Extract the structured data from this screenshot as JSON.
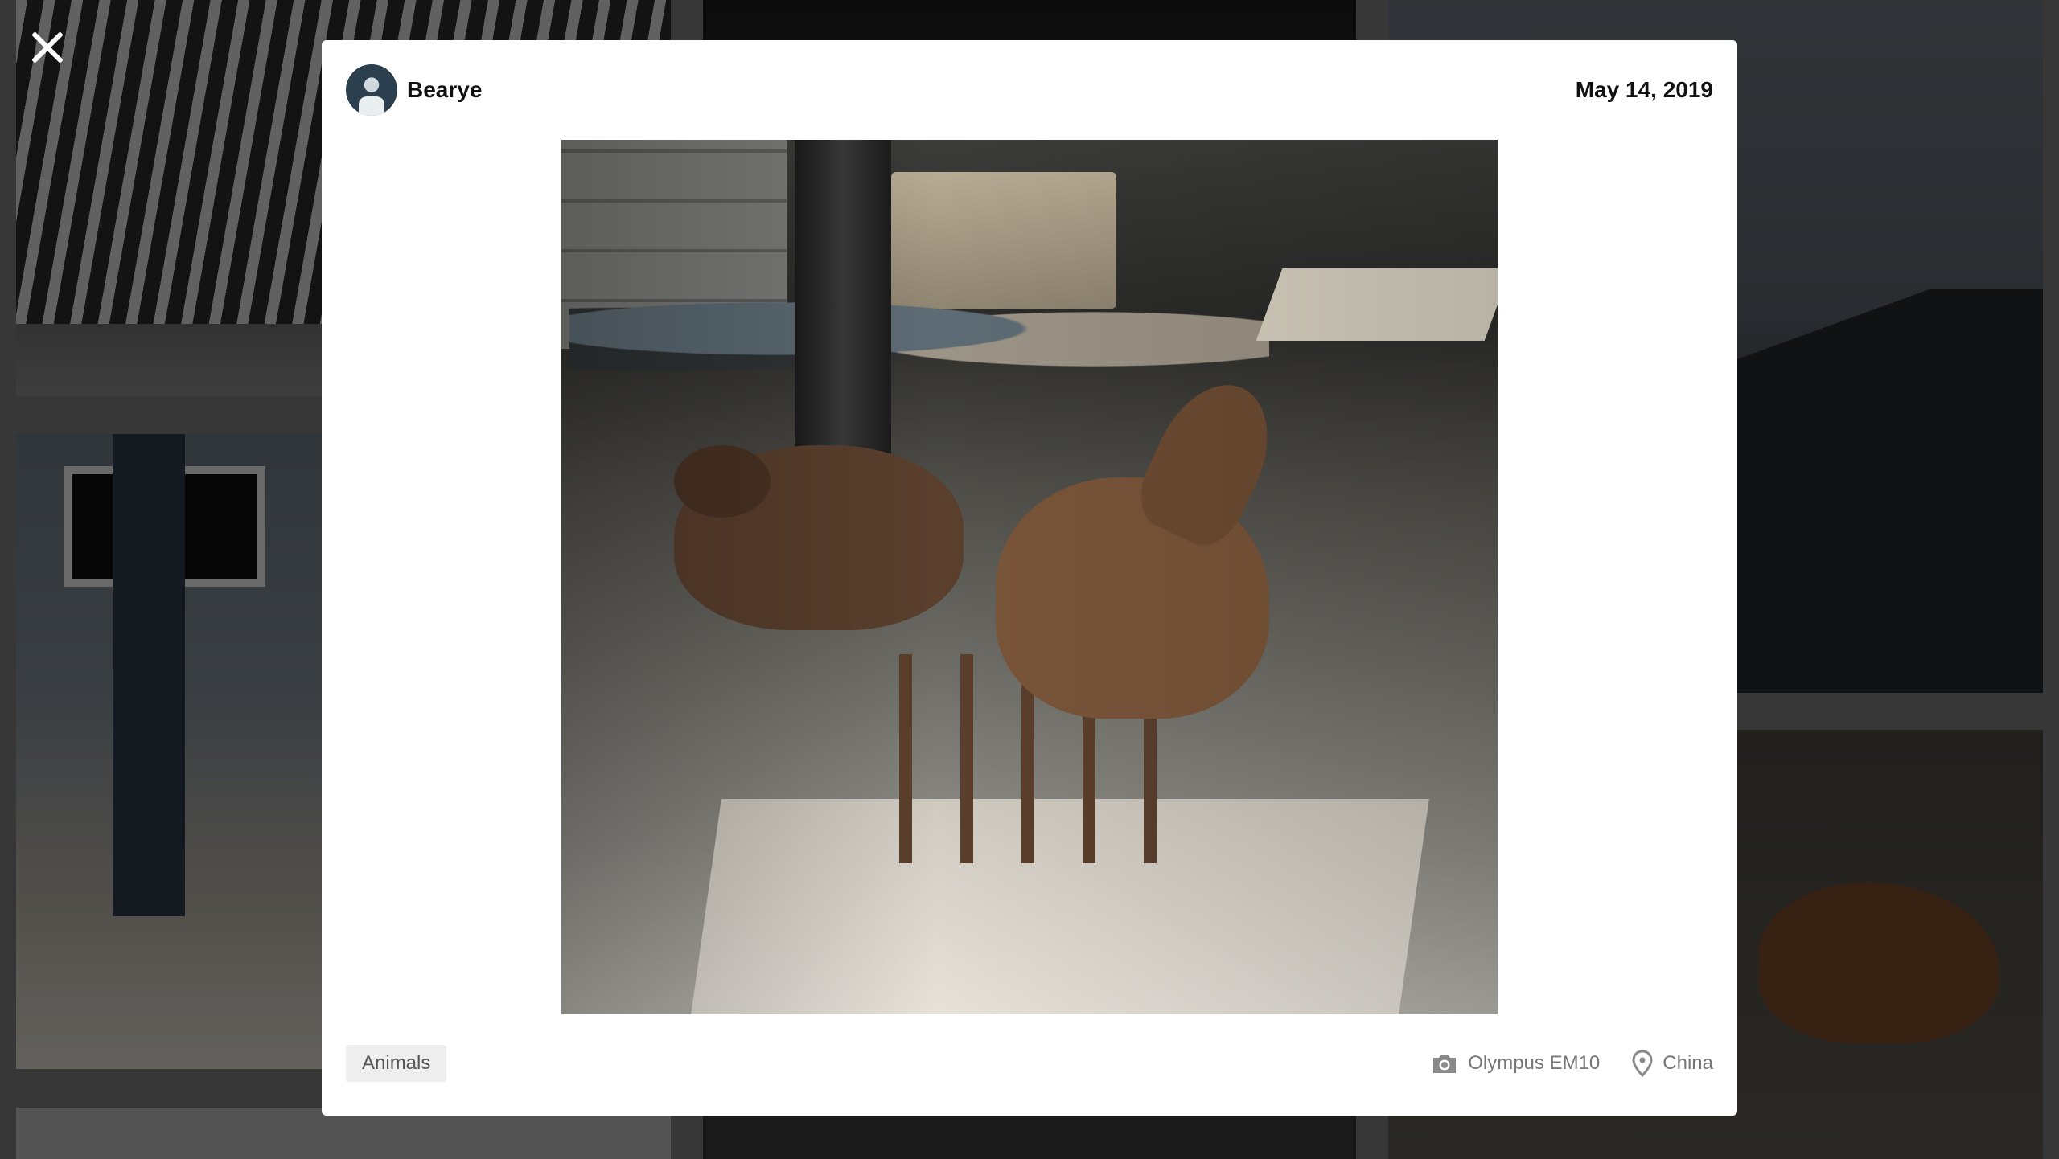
{
  "modal": {
    "author": {
      "name": "Bearye"
    },
    "date": "May 14, 2019",
    "photo": {
      "alt": "Two deer standing on a stone path"
    },
    "tag": "Animals",
    "camera": "Olympus EM10",
    "location": "China"
  },
  "icons": {
    "close": "close-icon",
    "camera": "camera-icon",
    "location": "location-pin-icon"
  },
  "colors": {
    "overlay": "#000000",
    "modal_bg": "#ffffff",
    "text_primary": "#111111",
    "text_meta": "#777777",
    "tag_bg": "#eeeeee"
  }
}
